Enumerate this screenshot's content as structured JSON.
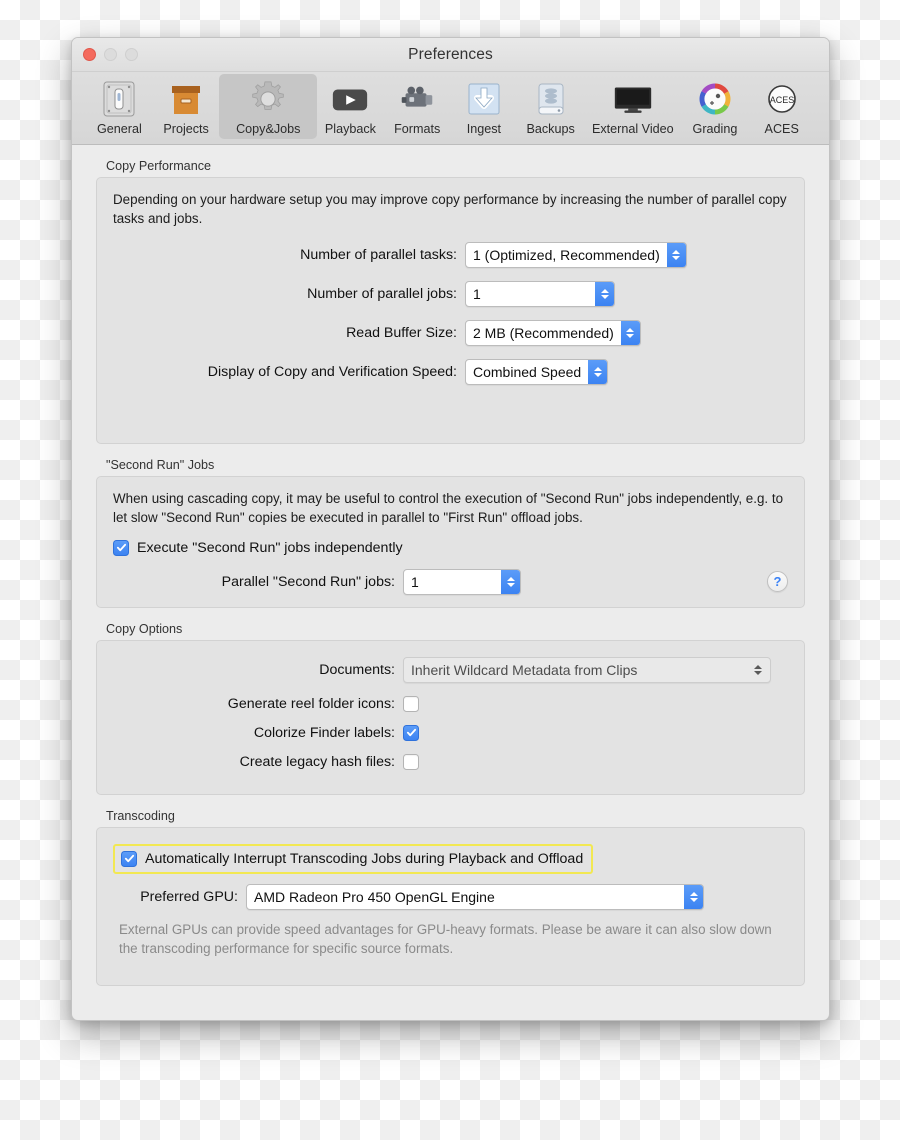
{
  "window": {
    "title": "Preferences",
    "traffic_lights": [
      "close",
      "minimize",
      "zoom"
    ]
  },
  "toolbar": {
    "items": [
      {
        "label": "General",
        "icon": "switch-plate-icon"
      },
      {
        "label": "Projects",
        "icon": "archive-box-icon"
      },
      {
        "label": "Copy&Jobs",
        "icon": "gear-icon",
        "selected": true
      },
      {
        "label": "Playback",
        "icon": "play-button-icon"
      },
      {
        "label": "Formats",
        "icon": "camcorder-icon"
      },
      {
        "label": "Ingest",
        "icon": "download-arrow-icon"
      },
      {
        "label": "Backups",
        "icon": "disk-drive-icon"
      },
      {
        "label": "External Video",
        "icon": "monitor-icon"
      },
      {
        "label": "Grading",
        "icon": "color-wheel-icon"
      },
      {
        "label": "ACES",
        "icon": "aces-circle-icon"
      }
    ]
  },
  "copy_performance": {
    "group_label": "Copy Performance",
    "description": "Depending on your hardware setup you may improve copy performance by increasing the number of parallel copy tasks and jobs.",
    "fields": [
      {
        "label": "Number of parallel tasks:",
        "value": "1 (Optimized, Recommended)"
      },
      {
        "label": "Number of parallel jobs:",
        "value": "1"
      },
      {
        "label": "Read Buffer Size:",
        "value": "2 MB (Recommended)"
      },
      {
        "label": "Display of Copy and Verification Speed:",
        "value": "Combined Speed"
      }
    ]
  },
  "second_run": {
    "group_label": "\"Second Run\" Jobs",
    "description": "When using cascading copy, it may be useful to control the execution of \"Second Run\" jobs independently, e.g. to let slow \"Second Run\" copies be executed in parallel to \"First Run\" offload jobs.",
    "checkbox": {
      "label": "Execute \"Second Run\" jobs independently",
      "checked": true
    },
    "field": {
      "label": "Parallel \"Second Run\" jobs:",
      "value": "1"
    },
    "help_label": "?"
  },
  "copy_options": {
    "group_label": "Copy Options",
    "documents": {
      "label": "Documents:",
      "value": "Inherit Wildcard Metadata from Clips"
    },
    "checkboxes": [
      {
        "label": "Generate reel folder icons:",
        "checked": false
      },
      {
        "label": "Colorize Finder labels:",
        "checked": true
      },
      {
        "label": "Create legacy hash files:",
        "checked": false
      }
    ]
  },
  "transcoding": {
    "group_label": "Transcoding",
    "interrupt_checkbox": {
      "label": "Automatically Interrupt Transcoding Jobs during Playback and Offload",
      "checked": true,
      "highlighted": true
    },
    "gpu": {
      "label": "Preferred GPU:",
      "value": "AMD Radeon Pro 450 OpenGL Engine"
    },
    "note": "External GPUs can provide speed advantages for GPU-heavy formats. Please be aware it can also slow down the transcoding performance for specific source formats."
  },
  "colors": {
    "accent_blue": "#3c83f2",
    "highlight_yellow": "#f2e852",
    "close_red": "#f46a5d",
    "window_bg": "#ececec",
    "group_bg": "#e3e3e3"
  }
}
